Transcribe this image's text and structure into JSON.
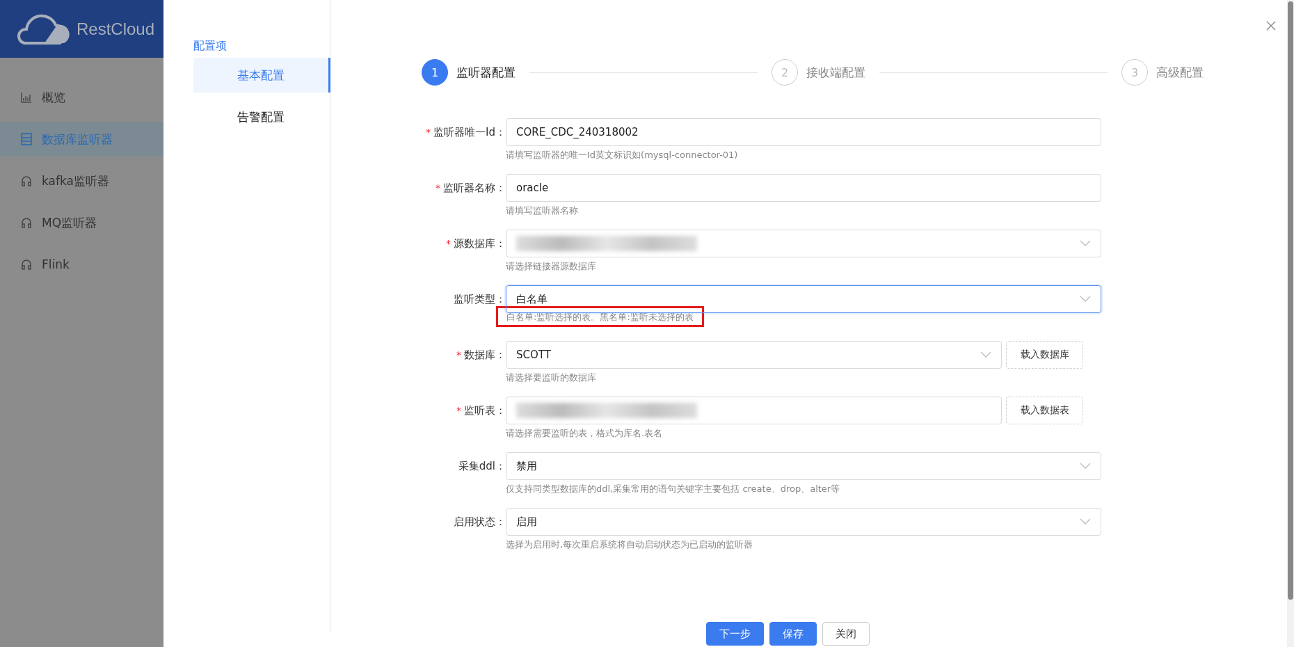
{
  "sidebar": {
    "logo": "RestCloud",
    "items": [
      {
        "label": "概览",
        "kind": "chart",
        "selected": false
      },
      {
        "label": "数据库监听器",
        "kind": "database",
        "selected": true
      },
      {
        "label": "kafka监听器",
        "kind": "headset",
        "selected": false
      },
      {
        "label": "MQ监听器",
        "kind": "headset",
        "selected": false
      },
      {
        "label": "Flink",
        "kind": "headset",
        "selected": false
      }
    ]
  },
  "drawer": {
    "config_nav": {
      "title": "配置项",
      "items": [
        {
          "label": "基本配置",
          "selected": true
        },
        {
          "label": "告警配置",
          "selected": false
        }
      ]
    },
    "steps": [
      {
        "number": "1",
        "label": "监听器配置",
        "selected": true
      },
      {
        "number": "2",
        "label": "接收端配置",
        "selected": false
      },
      {
        "number": "3",
        "label": "高级配置",
        "selected": false
      }
    ],
    "fields": [
      {
        "label": "监听器唯一Id：",
        "required_mark": "*",
        "kind": "input",
        "value": "CORE_CDC_240318002",
        "help": "请填写监听器的唯一Id英文标识如(mysql-connector-01)"
      },
      {
        "label": "监听器名称：",
        "required_mark": "*",
        "kind": "input",
        "value": "oracle",
        "help": "请填写监听器名称"
      },
      {
        "label": "源数据库：",
        "required_mark": "*",
        "kind": "select",
        "redacted": true,
        "help": "请选择链接器源数据库"
      },
      {
        "label": "监听类型：",
        "kind": "select",
        "value": "白名单",
        "focused": true,
        "highlighted": true,
        "help": "白名单:监听选择的表。黑名单:监听未选择的表"
      },
      {
        "label": "数据库：",
        "required_mark": "*",
        "kind": "select",
        "value": "SCOTT",
        "button": "载入数据库",
        "help": "请选择要监听的数据库"
      },
      {
        "label": "监听表：",
        "required_mark": "*",
        "kind": "tags",
        "redacted": true,
        "button": "载入数据表",
        "help": "请选择需要监听的表，格式为库名.表名"
      },
      {
        "label": "采集ddl：",
        "kind": "select",
        "value": "禁用",
        "help": "仅支持同类型数据库的ddl,采集常用的语句关键字主要包括 create、drop、alter等"
      },
      {
        "label": "启用状态：",
        "kind": "select",
        "value": "启用",
        "help": "选择为启用时,每次重启系统将自动启动状态为已启动的监听器"
      }
    ],
    "buttons": [
      {
        "label": "下一步",
        "kind": "primary"
      },
      {
        "label": "保存",
        "kind": "primary"
      },
      {
        "label": "关闭",
        "kind": "default"
      }
    ]
  }
}
